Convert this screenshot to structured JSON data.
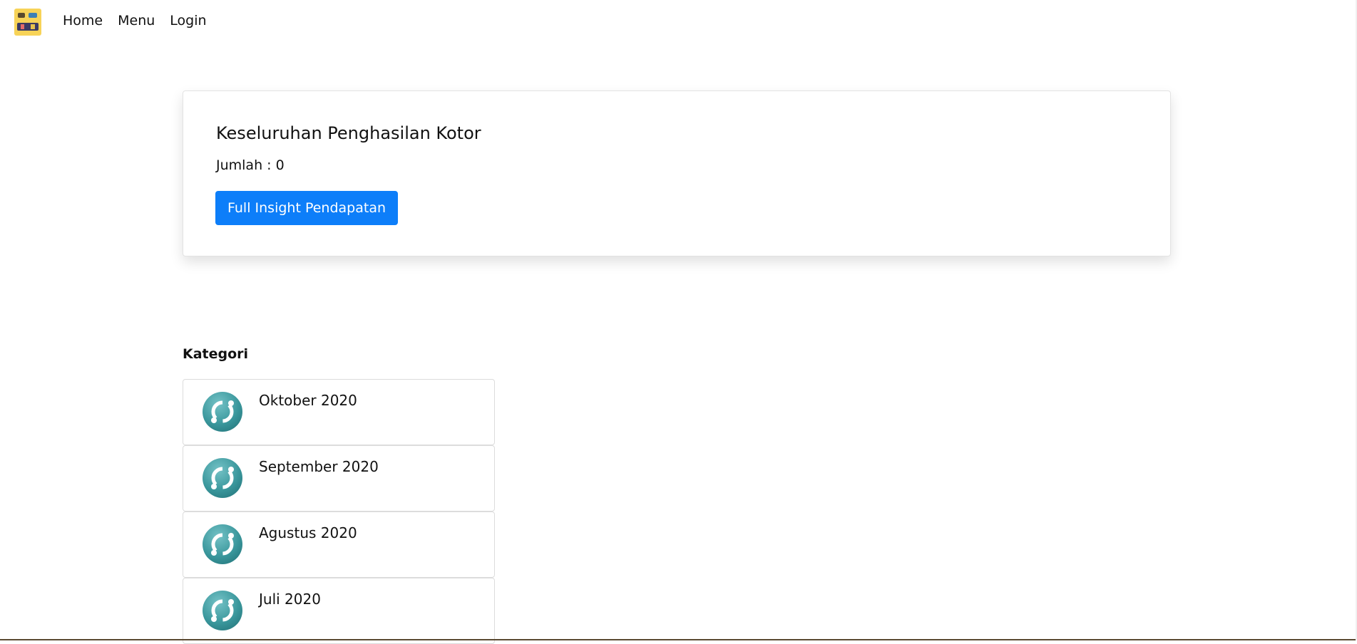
{
  "nav": {
    "links": [
      "Home",
      "Menu",
      "Login"
    ]
  },
  "summary_card": {
    "title": "Keseluruhan Penghasilan Kotor",
    "amount_text": "Jumlah : 0",
    "button_label": "Full Insight Pendapatan"
  },
  "kategori": {
    "title": "Kategori",
    "items": [
      {
        "label": "Oktober 2020",
        "icon": "icon-crypto-icon"
      },
      {
        "label": "September 2020",
        "icon": "icon-crypto-icon"
      },
      {
        "label": "Agustus 2020",
        "icon": "icon-crypto-icon"
      },
      {
        "label": "Juli 2020",
        "icon": "icon-crypto-icon"
      }
    ]
  },
  "colors": {
    "primary": "#0d7ef9",
    "icon_teal": "#3a979c"
  }
}
